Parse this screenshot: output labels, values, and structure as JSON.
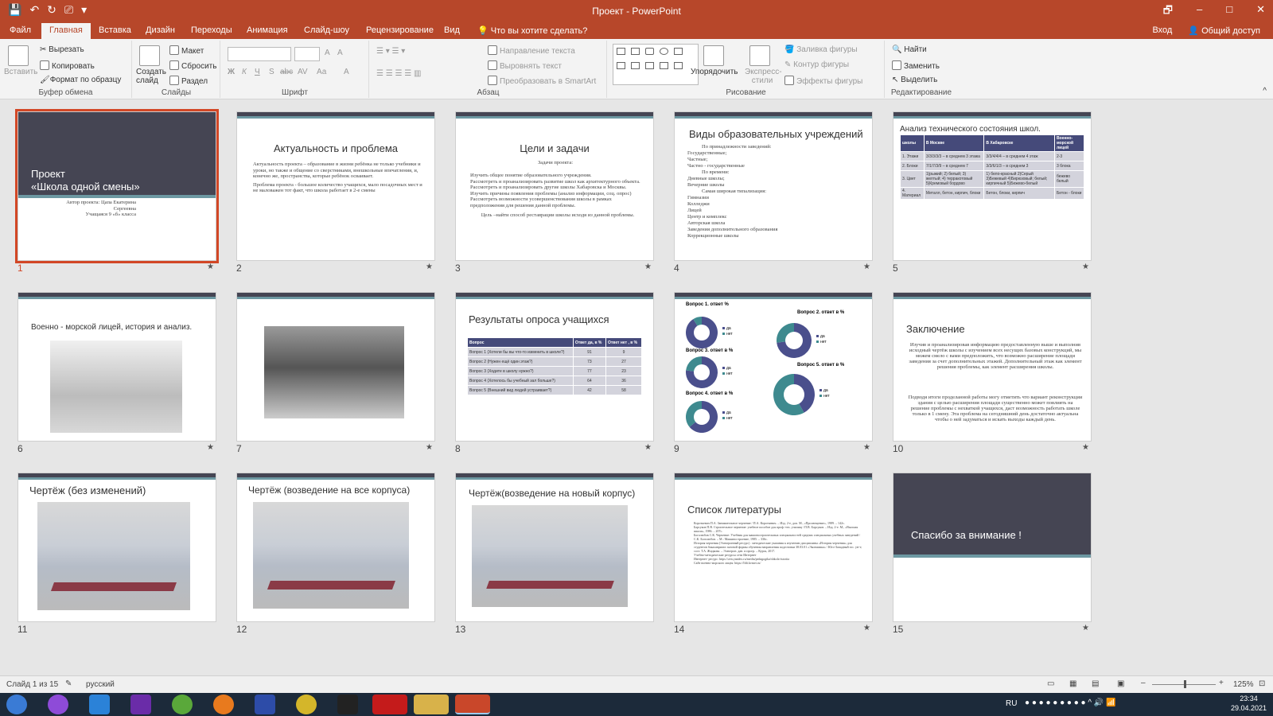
{
  "window": {
    "title": "Проект - PowerPoint",
    "qat": [
      "💾",
      "↶",
      "↻",
      "⎚",
      "▾"
    ],
    "controls": [
      "🗗",
      "–",
      "□",
      "✕"
    ]
  },
  "tabs": [
    "Файл",
    "Главная",
    "Вставка",
    "Дизайн",
    "Переходы",
    "Анимация",
    "Слайд-шоу",
    "Рецензирование",
    "Вид"
  ],
  "active_tab": "Главная",
  "tell_me": "Что вы хотите сделать?",
  "signin": "Вход",
  "share": "Общий доступ",
  "ribbon": {
    "clipboard": {
      "label": "Буфер обмена",
      "paste": "Вставить",
      "cut": "Вырезать",
      "copy": "Копировать",
      "format_painter": "Формат по образцу"
    },
    "slides": {
      "label": "Слайды",
      "new_slide": "Создать слайд",
      "layout": "Макет",
      "reset": "Сбросить",
      "section": "Раздел"
    },
    "font": {
      "label": "Шрифт",
      "bold": "Ж",
      "italic": "К",
      "underline": "Ч",
      "shadow": "S",
      "strike": "abc",
      "spacing": "AV",
      "case": "Аа",
      "color": "A",
      "grow": "A",
      "shrink": "A"
    },
    "paragraph": {
      "label": "Абзац",
      "direction": "Направление текста",
      "align": "Выровнять текст",
      "smartart": "Преобразовать в SmartArt"
    },
    "drawing": {
      "label": "Рисование",
      "arrange": "Упорядочить",
      "styles": "Экспресс-стили",
      "fill": "Заливка фигуры",
      "outline": "Контур фигуры",
      "effects": "Эффекты фигуры"
    },
    "editing": {
      "label": "Редактирование",
      "find": "Найти",
      "replace": "Заменить",
      "select": "Выделить"
    }
  },
  "slides": [
    {
      "n": "1",
      "title": "Проект\n«Школа одной смены»",
      "sub1": "Автор проекта: Цапа Екатерина",
      "sub2": "Сергеевна",
      "sub3": "Учащаяся 9 «б» класса"
    },
    {
      "n": "2",
      "title": "Актуальность и проблема",
      "b1": "Актуальность проекта – образование в жизни ребёнка не только учебники и уроки, но также и общение со сверстниками, внешкольные впечатления, и, конечно же, пространства, которые ребёнок осваивает.",
      "b2": "Проблема проекта - большое количество учащихся, мало посадочных мест и не маловажен тот факт, что школа работает в 2-е смены"
    },
    {
      "n": "3",
      "title": "Цели и задачи",
      "sub": "Задачи проекта:",
      "items": [
        "Изучить общее понятие образовательного учреждения.",
        "Рассмотреть и проанализировать развитие школ как архитектурного объекта.",
        "Рассмотреть и проанализировать другие школы Хабаровска и Москвы.",
        "Изучить причины появления проблемы (анализ информации, соц. опрос)",
        "Рассмотреть возможности усовершенствования школы в рамках предположения для решения данной проблемы."
      ],
      "goal": "Цель –найти способ реставрации школы исходя из данной проблемы."
    },
    {
      "n": "4",
      "title": "Виды образовательных учреждений",
      "lines": [
        "По принадлежности заведений:",
        "Государственные;",
        "Частные;",
        "Частно - государственные",
        "По времени:",
        "Дневные школы;",
        "Вечерние школы",
        "Самая широкая типализация:",
        "Гимназии",
        "Колледжи",
        "Лицей",
        "Центр и комплекс",
        "Авторская школа",
        "Заведения дополнительного образования",
        "Коррекционные школы"
      ]
    },
    {
      "n": "5",
      "title": "Анализ технического состояния школ.",
      "head": [
        "школы",
        "В Москве",
        "В Хабаровске",
        "Военно-морской лицей"
      ],
      "rows": [
        [
          "1. Этажи",
          "3/3/3/3/3 – в среднем 3 этажа",
          "3/3/4/4/4 – в среднем 4 этаж",
          "2-3"
        ],
        [
          "2. Блоки",
          "7/1/7/3/9 – в среднем 7",
          "3/3/6/1/3 – в среднем 3",
          "3 блока"
        ],
        [
          "3. Цвет",
          "1)рыжий; 2) белый; 3) желтый; 4) терракотовый 5)Кремовый бордово",
          "1) бело-красный 2)Серый 3)Бежевый 4)Бирюзовый; белый; кирпичный 5)Бежево-белый",
          "бежево белый"
        ],
        [
          "4. Материал",
          "Металл, бетон, кирпич, блоки",
          "Бетон, блоки, кирпич",
          "Бетон - блоки"
        ]
      ]
    },
    {
      "n": "6",
      "title": "Военно - морской лицей, история и анализ."
    },
    {
      "n": "7"
    },
    {
      "n": "8",
      "title": "Результаты опроса учащихся",
      "head": [
        "Вопрос",
        "Ответ да, в %",
        "Ответ нет , в %"
      ],
      "rows": [
        [
          "Вопрос 1 (Хотели бы вы что-то изменить в школе?)",
          "91",
          "9"
        ],
        [
          "Вопрос 2 (Нужен ещё один этаж?)",
          "73",
          "27"
        ],
        [
          "Вопрос 3 (Ходите в школу нужно?)",
          "77",
          "23"
        ],
        [
          "Вопрос 4 (Хотелось бы учебный зал больше?)",
          "64",
          "36"
        ],
        [
          "Вопрос 5 (Внешний вид людей устраивает?)",
          "42",
          "58"
        ]
      ]
    },
    {
      "n": "9",
      "charts": [
        {
          "title": "Вопрос 1. ответ %",
          "yes": 91,
          "no": 9
        },
        {
          "title": "Вопрос 2. ответ в %",
          "yes": 73,
          "no": 27
        },
        {
          "title": "Вопрос 3. ответ в %",
          "yes": 77,
          "no": 23
        },
        {
          "title": "Вопрос 5. ответ в %",
          "yes": 42,
          "no": 58
        },
        {
          "title": "Вопрос 4. ответ в %",
          "yes": 64,
          "no": 36
        }
      ],
      "legend_yes": "да",
      "legend_no": "нет"
    },
    {
      "n": "10",
      "title": "Заключение",
      "p1": "Изучив и проанализировав информацию предоставленную выше и выполнив исходный чертёж школы с изучением всех несущих базовых конструкций, мы можем смело с вами предположить, что возможно расширение площади заведения за счет дополнительных этажей. Дополнительный этаж как элемент решения проблемы, как элемент расширения школы.",
      "p2": "Подводя итоги проделанной работы могу отметить что вариант реконструкции здания с целью расширения площади существенно может повлиять на решение проблемы с нехваткой учащихся, даст возможность работать школе только в 1 смену. Эта проблема на сегодняшний день достаточно актуальна чтобы о ней задуматься и искать выходы каждый день."
    },
    {
      "n": "11",
      "title": "Чертёж (без изменений)"
    },
    {
      "n": "12",
      "title": "Чертёж (возведение на все корпуса)"
    },
    {
      "n": "13",
      "title": "Чертёж(возведение на новый корпус)"
    },
    {
      "n": "14",
      "title": "Список литературы",
      "refs": [
        "Короткевич П.А. Занимательное черчение / П.А. Короткевич. – Изд. 2-е, доп. М., «Просвещение», 1989. – 142с.",
        "Барсуков П.В. Строительное черчение: учебное пособие для проф.-тех. училищ / П.В. Барсуков. – Изд. 2-е. М., «Высшая школа», 1986. – 207с.",
        "Боголюбов С.К. Черчение: Учебник для машиностроительных специальностей средних специальных учебных заведений / С.К. Боголюбов. – М.: Машиностроение, 1985. – 336с.",
        "История черчения (Электронный ресурс) : методические указания к изучению дисциплины «История черчения» для студентов бакалавриата заочной формы обучения направления подготовки 38.03.01 «Экономика» / Юго-Западный гос. ун-т; сост. Т.А. Жидкова. – Электрон. дан. и прогр. – Курск, 2017.",
        "Учебно-методические ресурсы сети Интернет",
        "Интернет- ресурс: https://zen.yandex.ru/media/pedagogika/shkola-istoriia",
        "Сайт военно-морского лицея: https://lfdi.kvmei.ru/"
      ]
    },
    {
      "n": "15",
      "title": "Спасибо за внимание !"
    }
  ],
  "status": {
    "slide_of": "Слайд 1 из 15",
    "lang": "русский",
    "zoom": "125%"
  },
  "tray": {
    "lang": "RU",
    "time": "23:34",
    "date": "29.04.2021"
  }
}
